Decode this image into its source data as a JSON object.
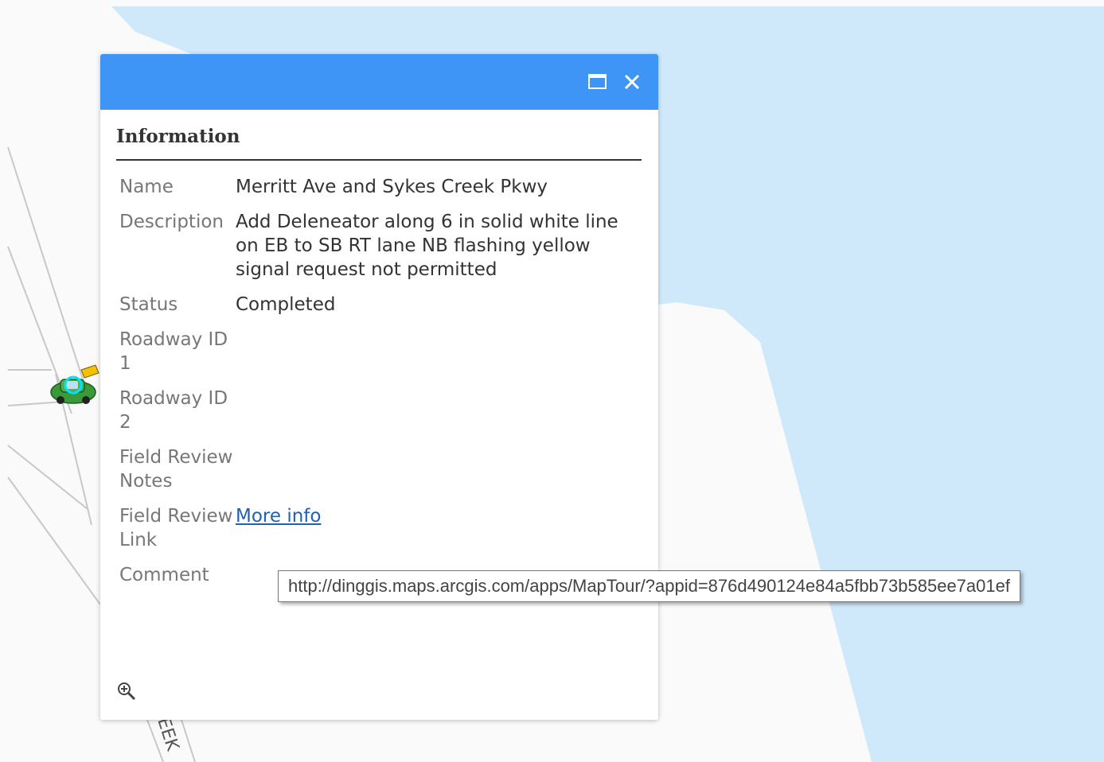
{
  "popup": {
    "title": "Information",
    "attributes": [
      {
        "name": "Name",
        "value": "Merritt Ave and Sykes Creek Pkwy"
      },
      {
        "name": "Description",
        "value": "Add Deleneator along 6 in solid white line on EB to SB RT lane NB flashing yellow signal request not permitted"
      },
      {
        "name": "Status",
        "value": "Completed"
      },
      {
        "name": "Roadway ID 1",
        "value": ""
      },
      {
        "name": "Roadway ID 2",
        "value": ""
      },
      {
        "name": "Field Review Notes",
        "value": ""
      },
      {
        "name": "Field Review Link",
        "link_text": "More info"
      },
      {
        "name": "Comment",
        "value": ""
      }
    ]
  },
  "tooltip": {
    "url": "http://dinggis.maps.arcgis.com/apps/MapTour/?appid=876d490124e84a5fbb73b585ee7a01ef"
  },
  "map": {
    "road_label": "EEK",
    "colors": {
      "water": "#cfe9fb",
      "land": "#fafafa",
      "road": "#c8c8c8",
      "header": "#3f95f5"
    }
  },
  "icons": [
    "maximize-icon",
    "close-icon",
    "zoom-to-icon",
    "car-marker-icon"
  ]
}
